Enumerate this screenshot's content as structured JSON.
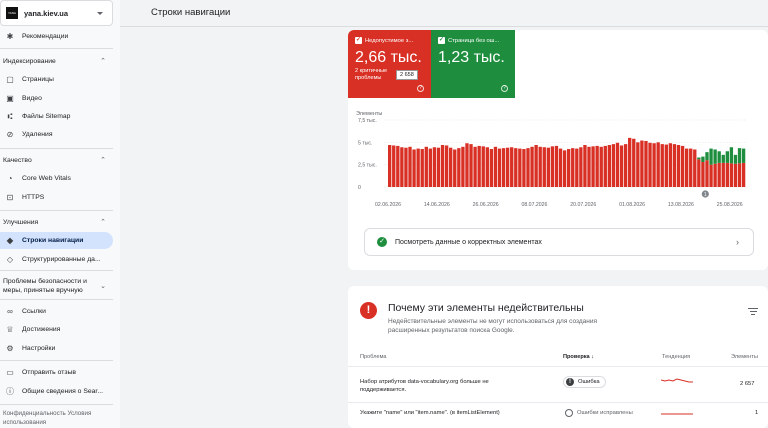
{
  "property": {
    "logo_text": "YANA",
    "name": "yana.kiev.ua"
  },
  "sidebar": {
    "recommendations": "Рекомендации",
    "indexing_header": "Индексирование",
    "indexing_items": [
      "Страницы",
      "Видео",
      "Файлы Sitemap",
      "Удаления"
    ],
    "quality_header": "Качество",
    "quality_items": [
      "Core Web Vitals",
      "HTTPS"
    ],
    "improvements_header": "Улучшения",
    "improvements_items": [
      "Строки навигации",
      "Структурированные да..."
    ],
    "security_header": "Проблемы безопасности и меры, принятые вручную",
    "links": "Ссылки",
    "achievements": "Достижения",
    "settings": "Настройки",
    "feedback": "Отправить отзыв",
    "about": "Общие сведения о Sear...",
    "footer": "Конфиденциальность  Условия использования"
  },
  "main": {
    "title": "Строки навигации"
  },
  "stats": {
    "invalid": {
      "label": "Недопустимое з...",
      "value": "2,66 тыс.",
      "sub": "2 критичные проблемы",
      "tooltip": "2 658",
      "color": "#d93025"
    },
    "valid": {
      "label": "Страница без ош...",
      "value": "1,23 тыс.",
      "color": "#1e8e3e"
    }
  },
  "chart_data": {
    "type": "bar",
    "ylabel": "Элементы",
    "y_ticks": [
      "7,5 тыс.",
      "5 тыс.",
      "2,5 тыс.",
      "0"
    ],
    "ylim": [
      0,
      7500
    ],
    "x_ticks": [
      "02.06.2026",
      "14.06.2026",
      "26.06.2026",
      "08.07.2026",
      "20.07.2026",
      "01.08.2026",
      "13.08.2026",
      "25.08.2026"
    ],
    "annotation": "1",
    "series": [
      {
        "name": "Недопустимое з...",
        "color": "#d93025",
        "values": [
          4700,
          4650,
          4600,
          4450,
          4400,
          4500,
          4200,
          4300,
          4250,
          4500,
          4300,
          4450,
          4400,
          4700,
          4650,
          4400,
          4200,
          4350,
          4500,
          4900,
          4800,
          4500,
          4600,
          4550,
          4450,
          4250,
          4500,
          4300,
          4350,
          4400,
          4450,
          4350,
          4300,
          4250,
          4350,
          4500,
          4700,
          4500,
          4450,
          4400,
          4550,
          4600,
          4300,
          4100,
          4250,
          4350,
          4300,
          4450,
          4700,
          4500,
          4550,
          4600,
          4500,
          4600,
          4700,
          4800,
          4950,
          4650,
          4800,
          5500,
          5400,
          5000,
          5200,
          5150,
          4950,
          4900,
          5000,
          4800,
          4750,
          4900,
          4800,
          4700,
          4600,
          4300,
          4300,
          4200,
          3100,
          2800,
          3000,
          2500,
          2600,
          2700,
          2700,
          2700,
          2650,
          2600,
          2650,
          2700
        ]
      },
      {
        "name": "Страница без ош...",
        "color": "#1e8e3e",
        "values": [
          0,
          0,
          0,
          0,
          0,
          0,
          0,
          0,
          0,
          0,
          0,
          0,
          0,
          0,
          0,
          0,
          0,
          0,
          0,
          0,
          0,
          0,
          0,
          0,
          0,
          0,
          0,
          0,
          0,
          0,
          0,
          0,
          0,
          0,
          0,
          0,
          0,
          0,
          0,
          0,
          0,
          0,
          0,
          0,
          0,
          0,
          0,
          0,
          0,
          0,
          0,
          0,
          0,
          0,
          0,
          0,
          0,
          0,
          0,
          0,
          0,
          0,
          0,
          0,
          0,
          0,
          0,
          0,
          0,
          0,
          0,
          0,
          0,
          0,
          0,
          0,
          200,
          600,
          900,
          1800,
          1600,
          1300,
          900,
          1300,
          1800,
          1000,
          1700,
          1600
        ]
      }
    ]
  },
  "valid_link": "Посмотреть данные о корректных элементах",
  "why": {
    "title": "Почему эти элементы недействительны",
    "desc": "Недействительные элементы не могут использоваться для создания расширенных результатов поиска Google."
  },
  "table": {
    "headers": {
      "problem": "Проблема",
      "check": "Проверка",
      "trend": "Тенденция",
      "items": "Элементы"
    },
    "rows": [
      {
        "problem": "Набор атрибутов data-vocabulary.org больше не поддерживается.",
        "status": "Ошибка",
        "count": "2 657"
      },
      {
        "problem": "Укажите \"name\" или \"item.name\". (в itemListElement)",
        "status": "Ошибки исправлены",
        "count": "1"
      }
    ]
  }
}
